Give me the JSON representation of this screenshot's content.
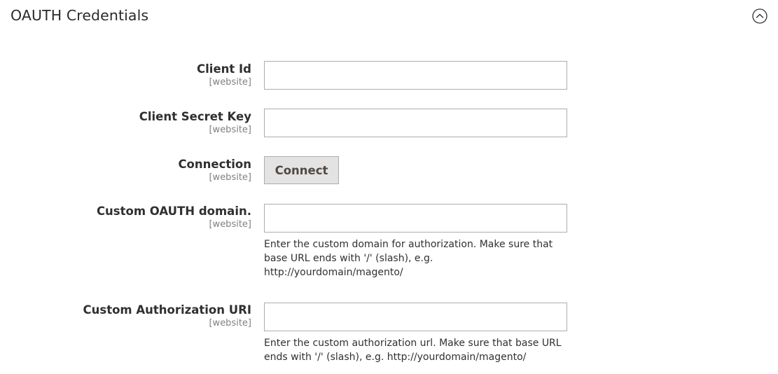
{
  "section": {
    "title": "OAUTH Credentials",
    "toggle_icon": "chevron-up-circle-icon"
  },
  "fields": [
    {
      "label": "Client Id",
      "scope": "[website]",
      "value": "",
      "placeholder": ""
    },
    {
      "label": "Client Secret Key",
      "scope": "[website]",
      "value": "",
      "placeholder": ""
    },
    {
      "label": "Connection",
      "scope": "[website]",
      "button_label": "Connect"
    },
    {
      "label": "Custom OAUTH domain.",
      "scope": "[website]",
      "value": "",
      "placeholder": "",
      "note_lines": [
        "Enter the custom domain for authorization. Make sure that",
        "base URL ends with '/' (slash), e.g.",
        "http://yourdomain/magento/"
      ]
    },
    {
      "label": "Custom Authorization URI",
      "scope": "[website]",
      "value": "",
      "placeholder": "",
      "note_lines": [
        "Enter the custom authorization url. Make sure that base URL",
        "ends with '/' (slash), e.g. http://yourdomain/magento/"
      ]
    }
  ],
  "colors": {
    "text": "#303030",
    "scope": "#808080",
    "input_border": "#adadad",
    "button_bg": "#e3e3e3"
  }
}
